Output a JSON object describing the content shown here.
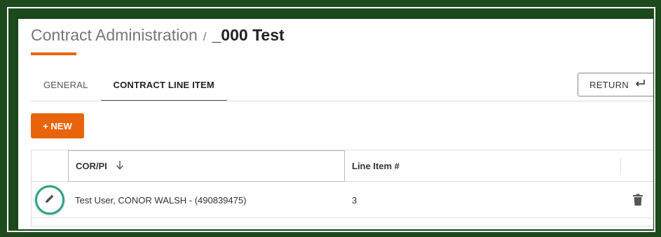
{
  "breadcrumb": {
    "parent": "Contract Administration",
    "separator": "/",
    "current": "_000 Test"
  },
  "tabs": [
    {
      "label": "GENERAL",
      "active": false
    },
    {
      "label": "CONTRACT LINE ITEM",
      "active": true
    }
  ],
  "toolbar": {
    "return_label": "RETURN",
    "new_label": "+ NEW"
  },
  "table": {
    "columns": [
      {
        "label": "COR/PI",
        "sort": "descending"
      },
      {
        "label": "Line Item #"
      }
    ],
    "rows": [
      {
        "cor_pi": "Test User, CONOR WALSH - (490839475)",
        "line_item": "3"
      }
    ]
  },
  "icons": {
    "sort": "arrow-down-icon",
    "return": "return-arrow-icon",
    "edit": "pencil-icon",
    "delete": "trash-icon"
  },
  "colors": {
    "accent": "#e8640c",
    "frame": "#1d4a1d",
    "highlight_ring": "#2aa386"
  }
}
